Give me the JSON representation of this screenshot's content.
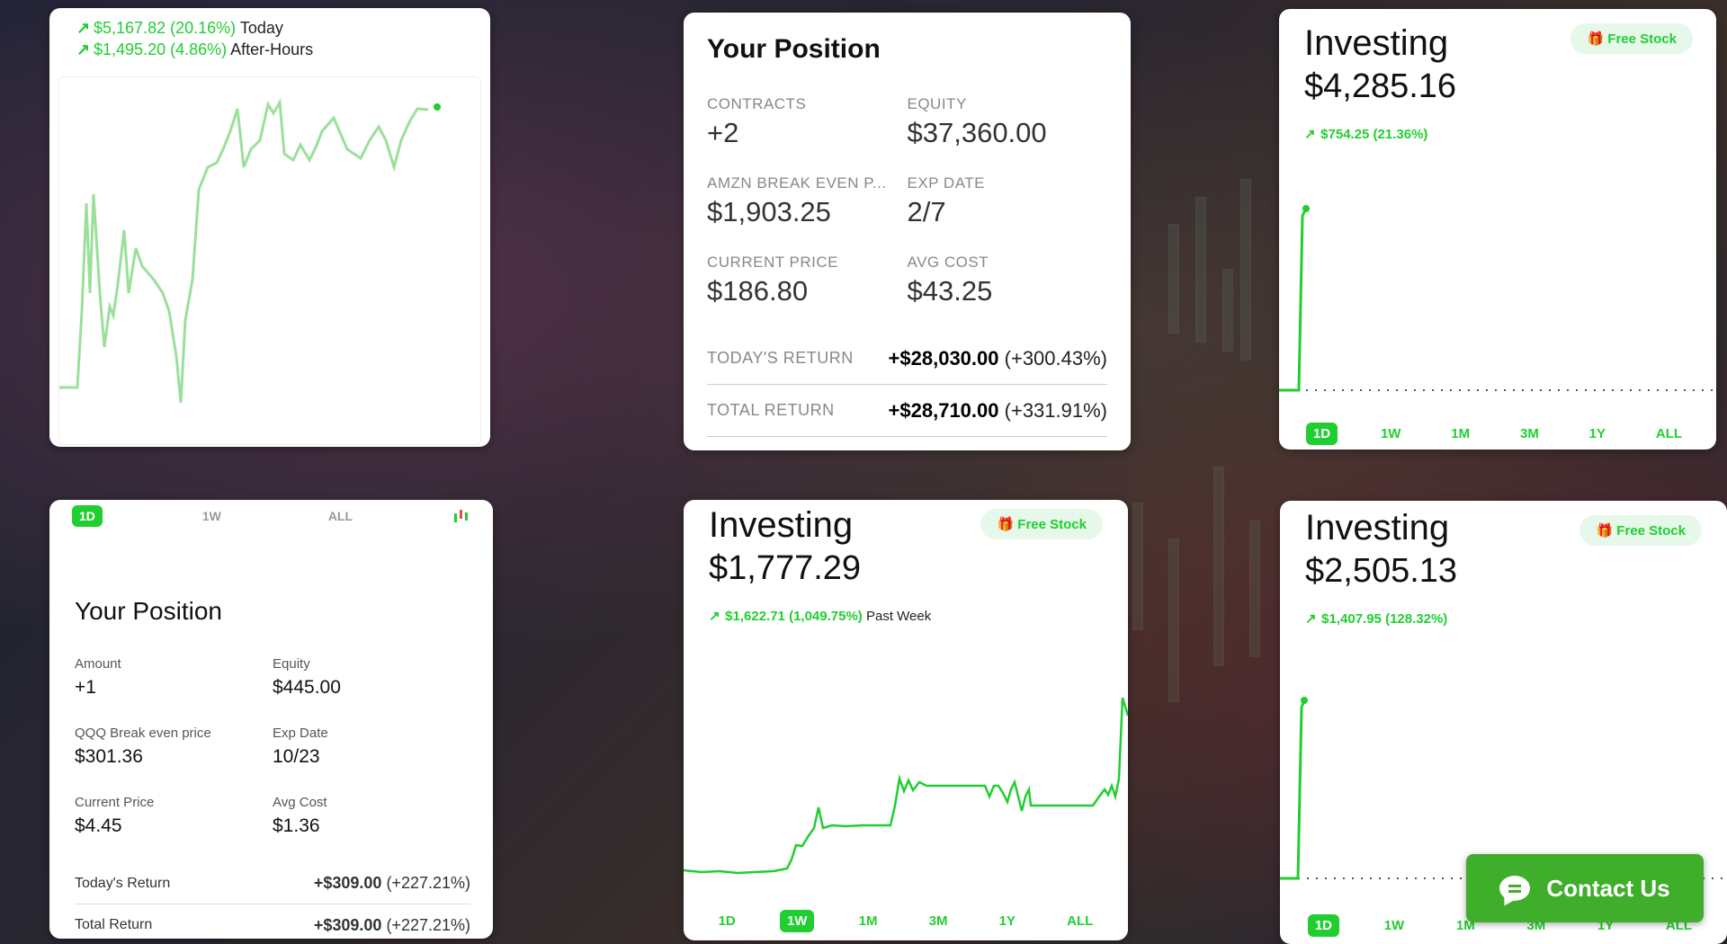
{
  "card1": {
    "today_change": "$5,167.82 (20.16%)",
    "today_label": "Today",
    "after_change": "$1,495.20 (4.86%)",
    "after_label": "After-Hours"
  },
  "card2": {
    "title": "Your Position",
    "contracts_label": "CONTRACTS",
    "contracts": "+2",
    "equity_label": "EQUITY",
    "equity": "$37,360.00",
    "breakeven_label": "AMZN BREAK EVEN P...",
    "breakeven": "$1,903.25",
    "expdate_label": "EXP DATE",
    "expdate": "2/7",
    "curprice_label": "CURRENT PRICE",
    "curprice": "$186.80",
    "avgcost_label": "AVG COST",
    "avgcost": "$43.25",
    "today_return_label": "TODAY'S RETURN",
    "today_return": "+$28,030.00",
    "today_return_pct": "(+300.43%)",
    "total_return_label": "TOTAL RETURN",
    "total_return": "+$28,710.00",
    "total_return_pct": "(+331.91%)"
  },
  "card3": {
    "title": "Investing",
    "amount": "$4,285.16",
    "free_stock": "Free Stock",
    "change": "$754.25 (21.36%)",
    "tabs": [
      "1D",
      "1W",
      "1M",
      "3M",
      "1Y",
      "ALL"
    ],
    "active_tab": "1D"
  },
  "card4": {
    "tabs": [
      "1D",
      "1W",
      "ALL"
    ],
    "title": "Your Position",
    "amount_label": "Amount",
    "amount": "+1",
    "equity_label": "Equity",
    "equity": "$445.00",
    "breakeven_label": "QQQ Break even price",
    "breakeven": "$301.36",
    "expdate_label": "Exp Date",
    "expdate": "10/23",
    "curprice_label": "Current Price",
    "curprice": "$4.45",
    "avgcost_label": "Avg Cost",
    "avgcost": "$1.36",
    "today_return_label": "Today's Return",
    "today_return": "+$309.00",
    "today_return_pct": "(+227.21%)",
    "total_return_label": "Total Return",
    "total_return": "+$309.00",
    "total_return_pct": "(+227.21%)"
  },
  "card5": {
    "title": "Investing",
    "amount": "$1,777.29",
    "free_stock": "Free Stock",
    "change": "$1,622.71 (1,049.75%)",
    "change_sub": "Past Week",
    "tabs": [
      "1D",
      "1W",
      "1M",
      "3M",
      "1Y",
      "ALL"
    ],
    "active_tab": "1W"
  },
  "card6": {
    "title": "Investing",
    "amount": "$2,505.13",
    "free_stock": "Free Stock",
    "change": "$1,407.95 (128.32%)",
    "tabs": [
      "1D",
      "1W",
      "1M",
      "3M",
      "1Y",
      "ALL"
    ],
    "active_tab": "1D"
  },
  "contact": {
    "label": "Contact Us"
  },
  "colors": {
    "green": "#21ce31",
    "line_light": "#9be09a",
    "contact_bg": "#3fae2a"
  }
}
